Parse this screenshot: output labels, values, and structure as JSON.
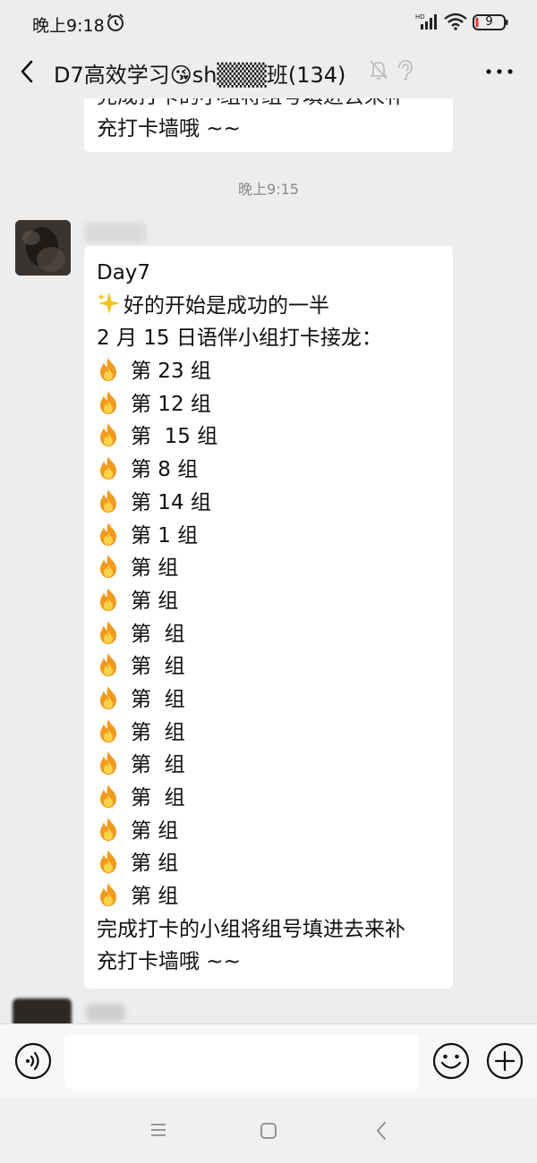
{
  "status_bar": {
    "time": "晚上9:18",
    "network": "HD",
    "battery": "9"
  },
  "nav": {
    "title": "D7高效学习😘sh▒▒▒班(134)"
  },
  "chat": {
    "previous_message": {
      "line1_cut": "完成打卡的小组将组号填进去来补",
      "line2": "充打卡墙哦 ~~"
    },
    "timestamp": "晚上9:15",
    "message": {
      "line_day": "Day7",
      "line_motto": "好的开始是成功的一半",
      "line_date": "2 月 15 日语伴小组打卡接龙：",
      "groups": [
        "第 23 组",
        "第 12 组",
        "第  15 组",
        "第 8 组",
        "第 14 组",
        "第 1 组",
        "第 组",
        "第 组",
        "第  组",
        "第  组",
        "第  组",
        "第  组",
        "第  组",
        "第  组",
        "第 组",
        "第 组",
        "第 组"
      ],
      "closing1": "完成打卡的小组将组号填进去来补",
      "closing2": "充打卡墙哦 ~~"
    }
  },
  "input_bar": {
    "placeholder": ""
  },
  "colors": {
    "background": "#ededed",
    "bubble": "#ffffff",
    "timestamp": "#8a8a8a"
  },
  "icons": [
    "alarm-icon",
    "signal-icon",
    "wifi-icon",
    "battery-icon",
    "back-icon",
    "mute-icon",
    "ear-icon",
    "more-icon",
    "flame-icon",
    "sparkle-icon",
    "voice-icon",
    "emoji-icon",
    "plus-icon",
    "menu-key-icon",
    "home-key-icon",
    "back-key-icon"
  ]
}
